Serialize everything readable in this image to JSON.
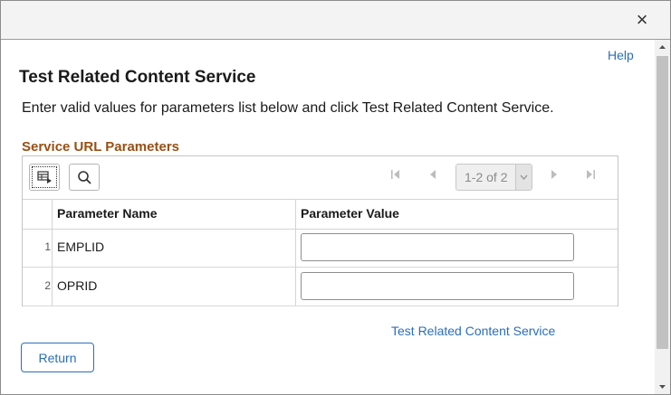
{
  "dialog": {
    "close_label": "×"
  },
  "header": {
    "help_label": "Help",
    "title": "Test Related Content Service",
    "instructions": "Enter valid values for parameters list below and click Test Related Content Service."
  },
  "grid": {
    "section_label": "Service URL Parameters",
    "toolbar": {
      "icons": [
        "personalize-grid-icon",
        "search-icon"
      ],
      "pager_text": "1-2 of 2",
      "nav_icons": [
        "first-page-icon",
        "previous-page-icon",
        "next-page-icon",
        "last-page-icon"
      ]
    },
    "columns": [
      "Parameter Name",
      "Parameter Value"
    ],
    "rows": [
      {
        "num": "1",
        "name": "EMPLID",
        "value": ""
      },
      {
        "num": "2",
        "name": "OPRID",
        "value": ""
      }
    ]
  },
  "actions": {
    "test_link": "Test Related Content Service",
    "return_label": "Return"
  },
  "colors": {
    "link": "#2a6ebb",
    "section_label": "#9a4f12",
    "titlebar": "#f3f3f3"
  }
}
